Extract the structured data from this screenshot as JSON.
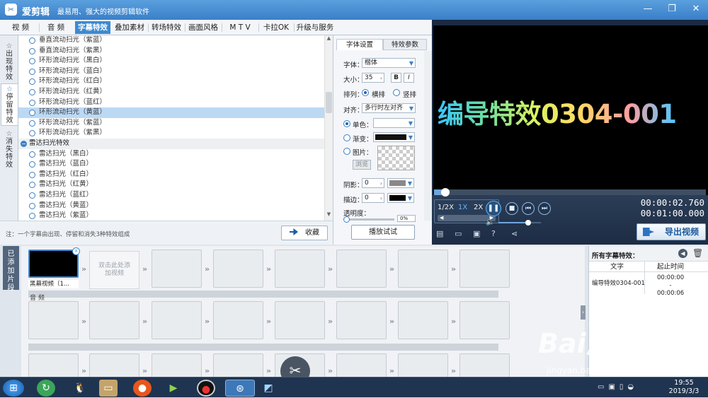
{
  "app": {
    "title": "爱剪辑",
    "slogan": "最易用、强大的视频剪辑软件"
  },
  "window_controls": {
    "minimize": "—",
    "restore": "❐",
    "close": "✕"
  },
  "tabs": [
    "视 频",
    "音 频",
    "字幕特效",
    "叠加素材",
    "转场特效",
    "画面风格",
    "M T V",
    "卡拉OK",
    "升级与服务"
  ],
  "active_tab": "字幕特效",
  "side_tabs": [
    "出现特效",
    "停留特效",
    "消失特效"
  ],
  "active_side_tab": "停留特效",
  "effects_list": [
    {
      "label": "垂直流动扫光（紫蓝）",
      "type": "item"
    },
    {
      "label": "垂直流动扫光（紫黑）",
      "type": "item"
    },
    {
      "label": "环形流动扫光（黑白）",
      "type": "item"
    },
    {
      "label": "环形流动扫光（蓝白）",
      "type": "item"
    },
    {
      "label": "环形流动扫光（红白）",
      "type": "item"
    },
    {
      "label": "环形流动扫光（红黄）",
      "type": "item"
    },
    {
      "label": "环形流动扫光（蓝红）",
      "type": "item"
    },
    {
      "label": "环形流动扫光（黄蓝）",
      "type": "item",
      "selected": true
    },
    {
      "label": "环形流动扫光（紫蓝）",
      "type": "item"
    },
    {
      "label": "环形流动扫光（紫黑）",
      "type": "item"
    },
    {
      "label": "雷达扫光特效",
      "type": "group"
    },
    {
      "label": "雷达扫光（黑白）",
      "type": "item"
    },
    {
      "label": "雷达扫光（蓝白）",
      "type": "item"
    },
    {
      "label": "雷达扫光（红白）",
      "type": "item"
    },
    {
      "label": "雷达扫光（红黄）",
      "type": "item"
    },
    {
      "label": "雷达扫光（蓝红）",
      "type": "item"
    },
    {
      "label": "雷达扫光（黄蓝）",
      "type": "item"
    },
    {
      "label": "雷达扫光（紫蓝）",
      "type": "item"
    }
  ],
  "hint": {
    "text": "注：一个字幕由出现、停留和消失3种特效组成",
    "collect": "收藏"
  },
  "props": {
    "tabs": [
      "字体设置",
      "特效参数"
    ],
    "font_label": "字体：",
    "font_value": "楷体",
    "size_label": "大小：",
    "size_value": "35",
    "bold": "B",
    "italic": "I",
    "layout_label": "排列：",
    "layout_options": [
      "横排",
      "竖排"
    ],
    "layout_selected": "横排",
    "align_label": "对齐：",
    "align_value": "多行时左对齐",
    "fill_options": [
      "单色：",
      "渐变：",
      "图片："
    ],
    "fill_selected": "单色：",
    "browse": "浏览",
    "shadow_label": "阴影：",
    "shadow_value": "0",
    "stroke_label": "描边：",
    "stroke_value": "0",
    "opacity_label": "透明度：",
    "opacity_value": "0%",
    "play_test": "播放试试"
  },
  "preview": {
    "caption": "编导特效0304-001",
    "progress": 0.03,
    "speeds": [
      "1/2X",
      "1X",
      "2X"
    ],
    "current_time": "00:00:02.760",
    "total_time": "00:01:00.000",
    "volume": 0.7,
    "export": "导出视频",
    "accent": "#3d8ad0"
  },
  "timeline": {
    "added_label": "已添加片段",
    "first_clip_label": "黑幕视频（1...",
    "add_clip_hint": "双击此处添加视频",
    "audio_label": "音 频"
  },
  "all_effects": {
    "title": "所有字幕特效：",
    "col_text": "文字",
    "col_time": "起止时间",
    "rows": [
      {
        "text": "编导特效0304-001",
        "start": "00:00:00",
        "end": "00:00:06"
      }
    ]
  },
  "taskbar": {
    "time": "19:55",
    "date": "2019/3/3"
  },
  "watermark": {
    "brand": "Bai度经验",
    "url": "jingyan.baidu.com"
  }
}
